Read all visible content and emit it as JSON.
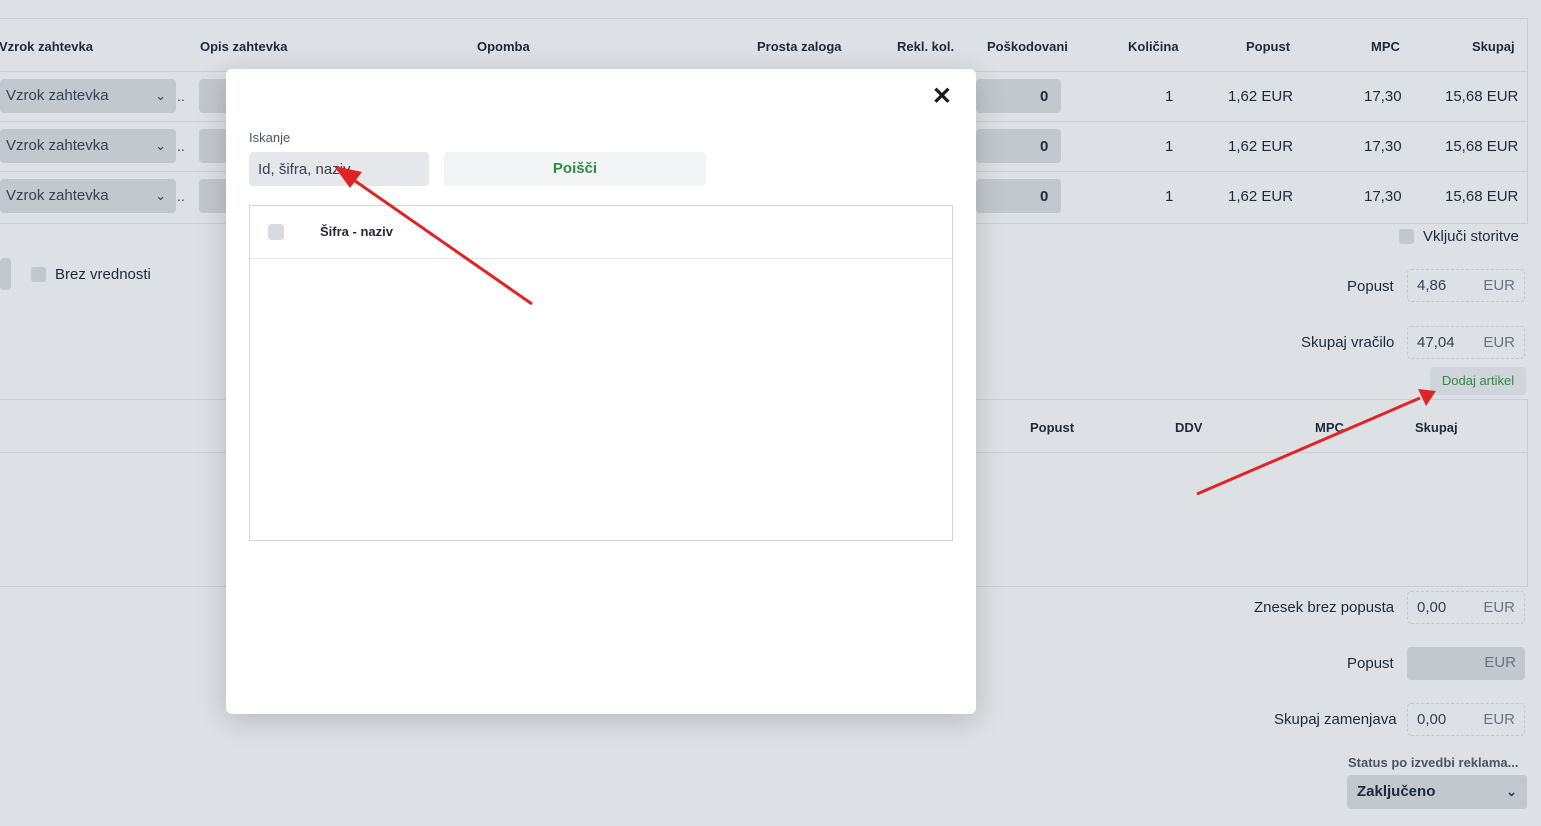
{
  "top_table": {
    "headers": [
      "Vzrok zahtevka",
      "Opis zahtevka",
      "Opomba",
      "Prosta zaloga",
      "Rekl. kol.",
      "Poškodovani",
      "Količina",
      "Popust",
      "MPC",
      "Skupaj"
    ],
    "rows": [
      {
        "vzrok": "Vzrok zahtevka",
        "dots": "..",
        "poskodovani": "0",
        "kolicina": "1",
        "popust": "1,62 EUR",
        "mpc": "17,30",
        "skupaj": "15,68 EUR"
      },
      {
        "vzrok": "Vzrok zahtevka",
        "dots": "..",
        "poskodovani": "0",
        "kolicina": "1",
        "popust": "1,62 EUR",
        "mpc": "17,30",
        "skupaj": "15,68 EUR"
      },
      {
        "vzrok": "Vzrok zahtevka",
        "dots": "..",
        "poskodovani": "0",
        "kolicina": "1",
        "popust": "1,62 EUR",
        "mpc": "17,30",
        "skupaj": "15,68 EUR"
      }
    ]
  },
  "options": {
    "vkljuci_storitve": "Vključi storitve",
    "brez_vrednosti": "Brez vrednosti"
  },
  "return_summary": {
    "popust_label": "Popust",
    "popust_value": "4,86",
    "popust_unit": "EUR",
    "skupaj_label": "Skupaj vračilo",
    "skupaj_value": "47,04",
    "skupaj_unit": "EUR",
    "add_button": "Dodaj artikel"
  },
  "bottom_table": {
    "headers": [
      "Popust",
      "DDV",
      "MPC",
      "Skupaj"
    ]
  },
  "exchange_summary": {
    "znesek_label": "Znesek brez popusta",
    "znesek_value": "0,00",
    "znesek_unit": "EUR",
    "popust_label": "Popust",
    "popust_unit": "EUR",
    "skupaj_label": "Skupaj zamenjava",
    "skupaj_value": "0,00",
    "skupaj_unit": "EUR",
    "status_label": "Status po izvedbi reklama...",
    "status_value": "Zaključeno"
  },
  "modal": {
    "close_glyph": "✕",
    "search_label": "Iskanje",
    "search_placeholder": "Id, šifra, naziv..",
    "search_button": "Poišči",
    "results_header": "Šifra - naziv"
  },
  "colors": {
    "background": "#dde1e6",
    "accent_green": "#2e8b3f",
    "arrow_red": "#e02424"
  }
}
